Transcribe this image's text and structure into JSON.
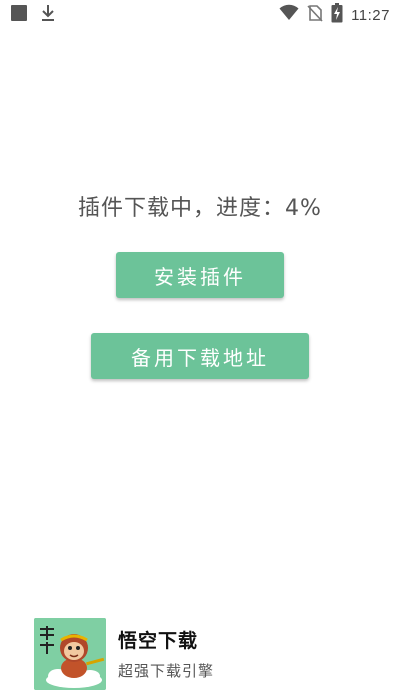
{
  "status_bar": {
    "time": "11:27",
    "left_icons": [
      "square-notification-icon",
      "download-icon"
    ],
    "right_icons": [
      "wifi-icon",
      "no-sim-icon",
      "battery-charging-icon"
    ]
  },
  "main": {
    "progress_text": "插件下载中，进度：4%",
    "progress_percent": 4,
    "install_button_label": "安装插件",
    "backup_button_label": "备用下载地址",
    "button_color": "#6cc399"
  },
  "app": {
    "name": "悟空下载",
    "slogan": "超强下载引擎",
    "icon_text": "悟空下载",
    "icon_color": "#7fcfa3"
  }
}
